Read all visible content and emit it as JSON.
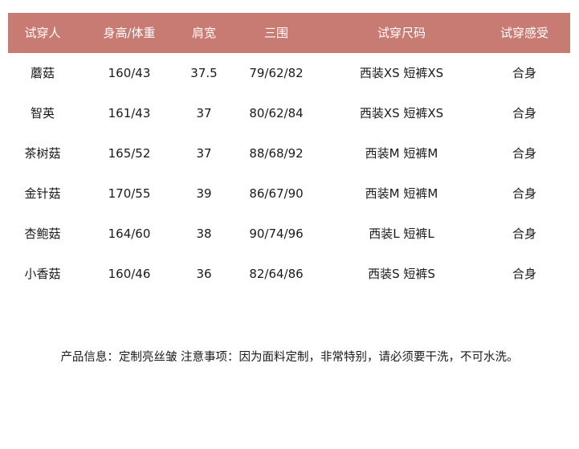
{
  "headers": [
    "试穿人",
    "身高/体重",
    "肩宽",
    "三围",
    "试穿尺码",
    "试穿感受"
  ],
  "rows": [
    [
      "蘑菇",
      "160/43",
      "37.5",
      "79/62/82",
      "西装XS 短裤XS",
      "合身"
    ],
    [
      "智英",
      "161/43",
      "37",
      "80/62/84",
      "西装XS 短裤XS",
      "合身"
    ],
    [
      "茶树菇",
      "165/52",
      "37",
      "88/68/92",
      "西装M  短裤M",
      "合身"
    ],
    [
      "金针菇",
      "170/55",
      "39",
      "86/67/90",
      "西装M 短裤M",
      "合身"
    ],
    [
      "杏鲍菇",
      "164/60",
      "38",
      "90/74/96",
      "西装L  短裤L",
      "合身"
    ],
    [
      "小香菇",
      "160/46",
      "36",
      "82/64/86",
      "西装S 短裤S",
      "合身"
    ]
  ],
  "note": "产品信息：定制亮丝皱 注意事项：因为面料定制，非常特别，请必须要干洗，不可水洗。",
  "colors": {
    "header_bg": "#c87b73",
    "header_text": "#ffffff",
    "body_text": "#1a1a1a"
  }
}
